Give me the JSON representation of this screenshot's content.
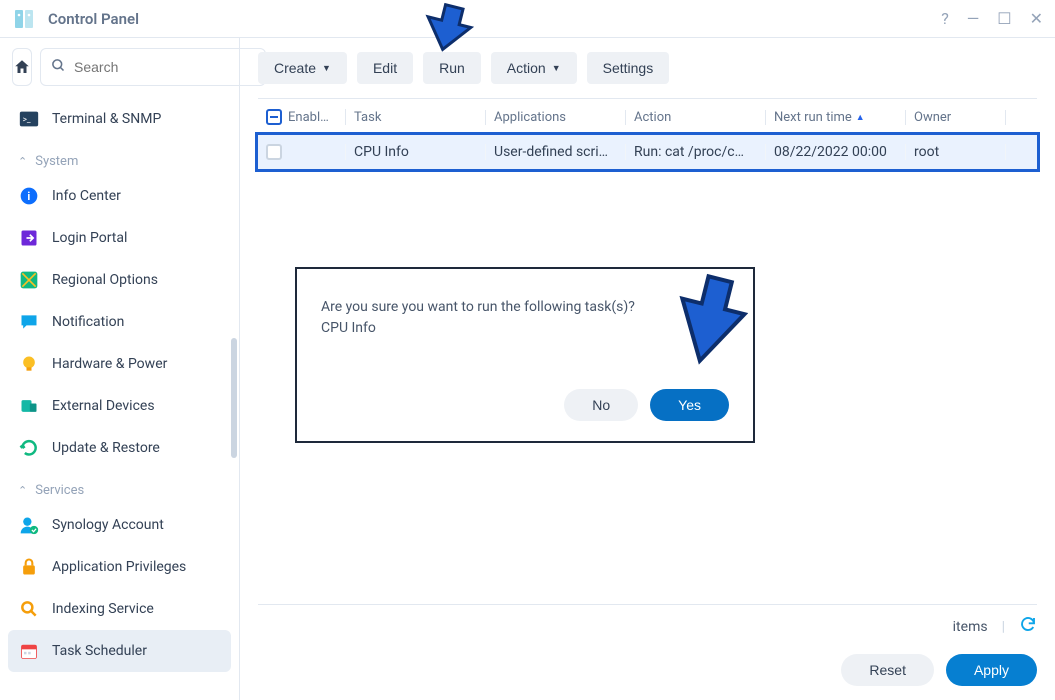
{
  "window": {
    "title": "Control Panel"
  },
  "search": {
    "placeholder": "Search"
  },
  "sidebar": {
    "terminal": "Terminal & SNMP",
    "group_system": "System",
    "system": {
      "info_center": "Info Center",
      "login_portal": "Login Portal",
      "regional": "Regional Options",
      "notification": "Notification",
      "hardware_power": "Hardware & Power",
      "external_devices": "External Devices",
      "update_restore": "Update & Restore"
    },
    "group_services": "Services",
    "services": {
      "synology_account": "Synology Account",
      "app_privileges": "Application Privileges",
      "indexing": "Indexing Service",
      "task_scheduler": "Task Scheduler"
    }
  },
  "toolbar": {
    "create": "Create",
    "edit": "Edit",
    "run": "Run",
    "action": "Action",
    "settings": "Settings"
  },
  "table": {
    "headers": {
      "enabled": "Enabl…",
      "task": "Task",
      "apps": "Applications",
      "action": "Action",
      "next": "Next run time",
      "owner": "Owner"
    },
    "rows": [
      {
        "task": "CPU Info",
        "apps": "User-defined scri…",
        "action": "Run: cat /proc/c…",
        "next": "08/22/2022 00:00",
        "owner": "root"
      }
    ]
  },
  "footer": {
    "items": "items",
    "reset": "Reset",
    "apply": "Apply"
  },
  "dialog": {
    "message": "Are you sure you want to run the following task(s)?",
    "detail": "CPU Info",
    "no": "No",
    "yes": "Yes"
  }
}
